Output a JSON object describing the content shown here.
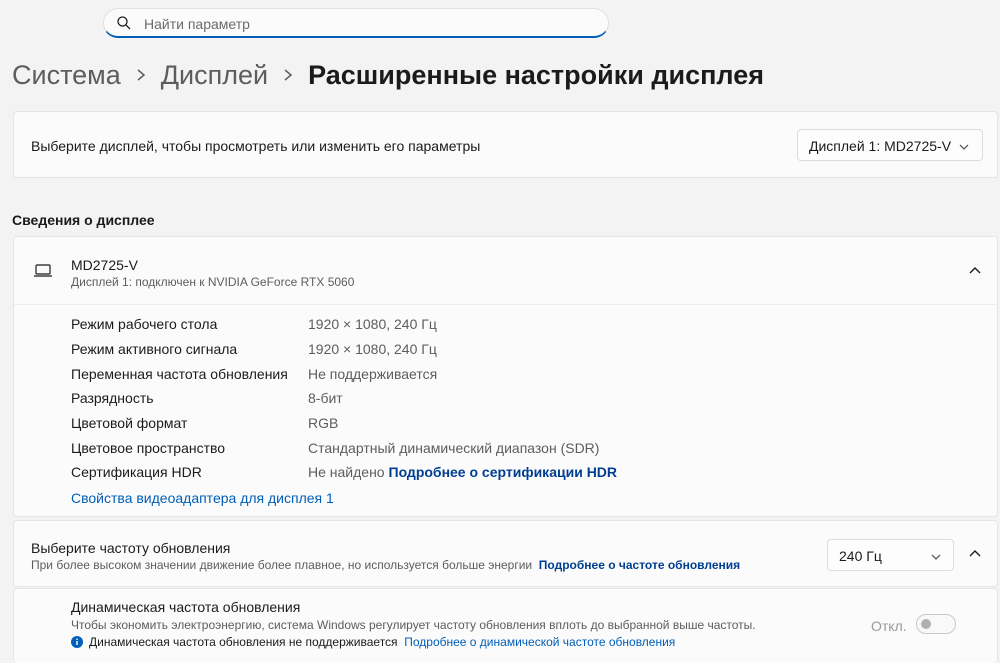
{
  "search": {
    "placeholder": "Найти параметр"
  },
  "breadcrumb": {
    "item1": "Система",
    "item2": "Дисплей",
    "current": "Расширенные настройки дисплея"
  },
  "display_select": {
    "label": "Выберите дисплей, чтобы просмотреть или изменить его параметры",
    "selected": "Дисплей 1: MD2725-V"
  },
  "info_section": {
    "title": "Сведения о дисплее",
    "monitor_name": "MD2725-V",
    "monitor_sub": "Дисплей 1: подключен к NVIDIA GeForce RTX 5060",
    "properties": [
      {
        "label": "Режим рабочего стола",
        "value": "1920 × 1080, 240 Гц"
      },
      {
        "label": "Режим активного сигнала",
        "value": "1920 × 1080, 240 Гц"
      },
      {
        "label": "Переменная частота обновления",
        "value": "Не поддерживается"
      },
      {
        "label": "Разрядность",
        "value": "8-бит"
      },
      {
        "label": "Цветовой формат",
        "value": "RGB"
      },
      {
        "label": "Цветовое пространство",
        "value": "Стандартный динамический диапазон (SDR)"
      },
      {
        "label": "Сертификация HDR",
        "value": "Не найдено",
        "link": "Подробнее о сертификации HDR"
      }
    ],
    "adapter_link": "Свойства видеоадаптера для дисплея 1"
  },
  "refresh": {
    "title": "Выберите частоту обновления",
    "subtitle": "При более высоком значении движение более плавное, но используется больше энергии",
    "link": "Подробнее о частоте обновления",
    "selected": "240 Гц"
  },
  "dynamic_refresh": {
    "title": "Динамическая частота обновления",
    "subtitle": "Чтобы экономить электроэнергию, система Windows регулирует частоту обновления вплоть до выбранной выше частоты.",
    "note": "Динамическая частота обновления не поддерживается",
    "link": "Подробнее о динамической частоте обновления",
    "toggle_label": "Откл.",
    "toggle_on": false
  },
  "colors": {
    "accent": "#005fb8",
    "link_bold": "#003e92",
    "background": "#f3f3f3",
    "card": "#fbfbfb"
  }
}
